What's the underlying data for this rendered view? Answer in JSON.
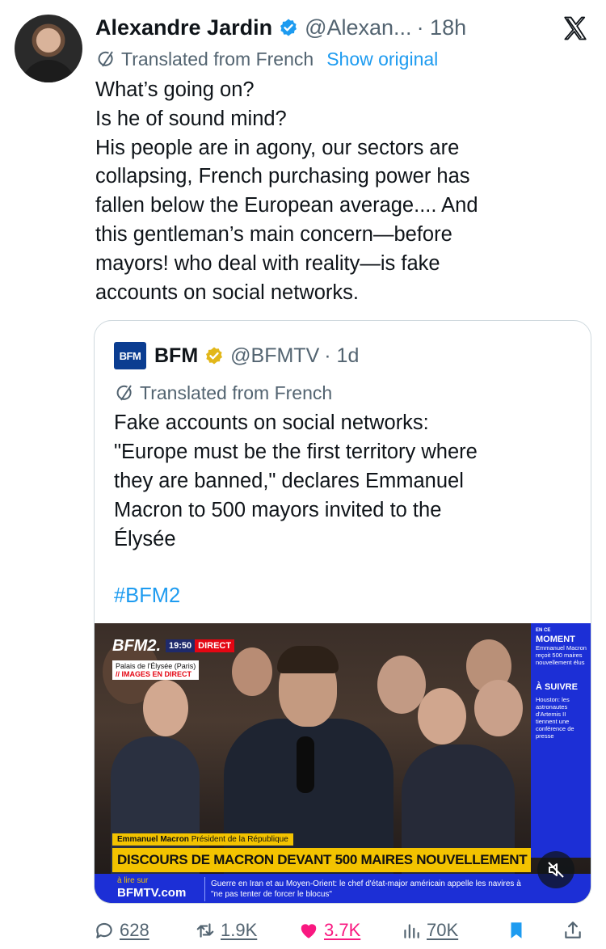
{
  "tweet": {
    "author": {
      "name": "Alexandre Jardin",
      "handle": "@Alexan...",
      "time": "· 18h"
    },
    "translation": {
      "label": "Translated from French",
      "show_original": "Show original"
    },
    "text_lines": [
      "What’s going on?",
      "Is he of sound mind?",
      "His people are in agony, our sectors are",
      "collapsing, French purchasing power has",
      "fallen below the European average.... And",
      "this gentleman’s main concern—before",
      "mayors! who deal with reality—is fake",
      "accounts on social networks."
    ],
    "platform_icon": "x-logo-icon"
  },
  "quote": {
    "author": {
      "name": "BFM",
      "handle": "@BFMTV",
      "time": "· 1d",
      "logo_text": "BFM"
    },
    "translation": {
      "label": "Translated from French"
    },
    "text_lines": [
      "Fake accounts on social networks:",
      "\"Europe must be the first territory where",
      "they are banned,\" declares Emmanuel",
      "Macron to 500 mayors invited to the",
      "Élysée"
    ],
    "hashtag": "#BFM2",
    "media": {
      "channel": "BFM2.",
      "time": "19:50",
      "live_badge": "DIRECT",
      "location": "Palais de l'Élysée (Paris)",
      "live_images": "// IMAGES EN DIRECT",
      "side_heading": "EN CE",
      "side_heading_2": "MOMENT",
      "side_now": "Emmanuel Macron reçoit 500 maires nouvellement élus",
      "side_next_heading": "À SUIVRE",
      "side_next": "Houston: les astronautes d'Artemis II tiennent une conférence de presse",
      "speaker_name": "Emmanuel Macron",
      "speaker_role": "Président de la République",
      "headline": "DISCOURS DE MACRON DEVANT 500 MAIRES NOUVELLEMENT ÉLUS",
      "ticker_read": "à lire sur",
      "ticker_site": "BFMTV.com",
      "ticker_news": "Guerre en Iran et au Moyen-Orient: le chef d'état-major américain appelle les navires à \"ne pas tenter de forcer le blocus\""
    }
  },
  "actions": {
    "replies": "628",
    "reposts": "1.9K",
    "likes": "3.7K",
    "views": "70K"
  },
  "colors": {
    "accent": "#1d9bf0",
    "like": "#f91880",
    "secondary_text": "#536471",
    "verified_blue": "#1d9bf0",
    "verified_gold": "#e2b719",
    "bfm_yellow": "#f3c300",
    "bfm_blue": "#1c2fd6"
  }
}
